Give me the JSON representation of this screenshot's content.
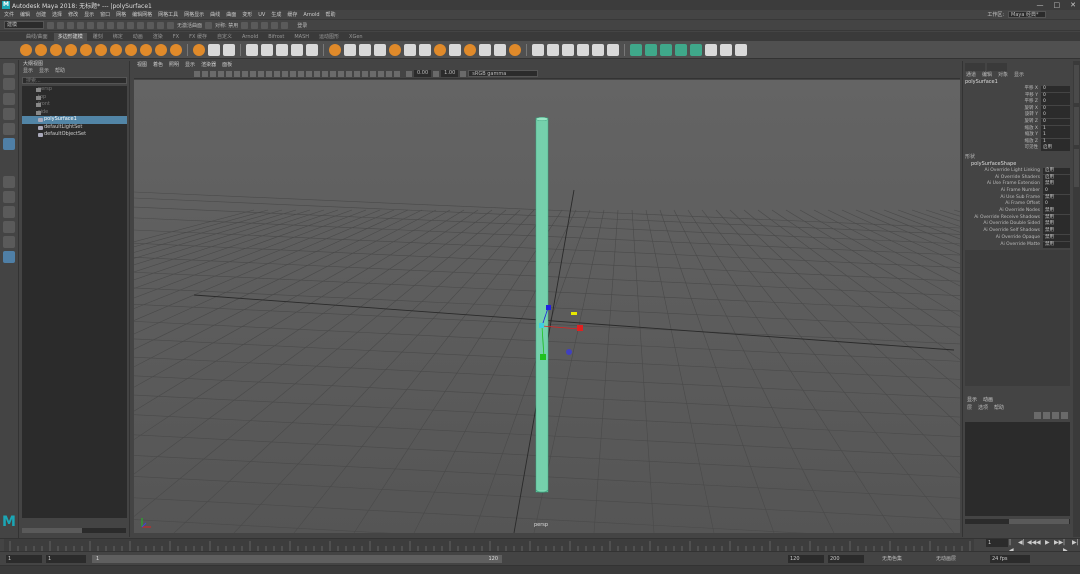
{
  "window": {
    "title": "Autodesk Maya 2018: 无标题*   ---   |polySurface1",
    "logo_letter": "M",
    "controls": [
      "—",
      "□",
      "✕"
    ]
  },
  "menubar": {
    "items": [
      "文件",
      "编辑",
      "创建",
      "选择",
      "修改",
      "显示",
      "窗口",
      "网格",
      "编辑网格",
      "网格工具",
      "网格显示",
      "曲线",
      "曲面",
      "变形",
      "UV",
      "生成",
      "缓存",
      "Arnold",
      "帮助"
    ],
    "workspace_label": "工作区:",
    "workspace_value": "Maya 经典*"
  },
  "statusline": {
    "mode_value": "建模",
    "no_live_surface": "无激活曲面",
    "symmetry": "对称: 禁用",
    "login": "登录"
  },
  "shelf": {
    "tabs": [
      "曲线/曲面",
      "多边形建模",
      "雕刻",
      "绑定",
      "动画",
      "渲染",
      "FX",
      "FX 缓存",
      "自定义",
      "Arnold",
      "Bifrost",
      "MASH",
      "运动图形",
      "XGen"
    ],
    "active_tab": 1
  },
  "outliner": {
    "panel_title": "大纲视图",
    "menu": [
      "显示",
      "显示",
      "帮助"
    ],
    "search_placeholder": "搜索...",
    "items": [
      {
        "label": "persp",
        "type": "camera"
      },
      {
        "label": "top",
        "type": "camera"
      },
      {
        "label": "front",
        "type": "camera"
      },
      {
        "label": "side",
        "type": "camera"
      },
      {
        "label": "polySurface1",
        "type": "object",
        "selected": true
      },
      {
        "label": "defaultLightSet",
        "type": "object"
      },
      {
        "label": "defaultObjectSet",
        "type": "object"
      }
    ]
  },
  "viewport": {
    "menu": [
      "视图",
      "着色",
      "照明",
      "显示",
      "渲染器",
      "面板"
    ],
    "exposure": "0.00",
    "gamma": "1.00",
    "colorspace": "sRGB gamma",
    "camera_label": "persp"
  },
  "channelbox": {
    "menu": [
      "通道",
      "编辑",
      "对象",
      "显示"
    ],
    "object_name": "polySurface1",
    "transform_attrs": [
      {
        "name": "平移 X",
        "value": "0"
      },
      {
        "name": "平移 Y",
        "value": "0"
      },
      {
        "name": "平移 Z",
        "value": "0"
      },
      {
        "name": "旋转 X",
        "value": "0"
      },
      {
        "name": "旋转 Y",
        "value": "0"
      },
      {
        "name": "旋转 Z",
        "value": "0"
      },
      {
        "name": "缩放 X",
        "value": "1"
      },
      {
        "name": "缩放 Y",
        "value": "1"
      },
      {
        "name": "缩放 Z",
        "value": "1"
      },
      {
        "name": "可见性",
        "value": "启用"
      }
    ],
    "shapes_label": "形状",
    "shape_name": "polySurfaceShape",
    "shape_attrs": [
      {
        "name": "Ai Override Light Linking",
        "value": "启用"
      },
      {
        "name": "Ai Override Shaders",
        "value": "启用"
      },
      {
        "name": "Ai Use Frame Extension",
        "value": "禁用"
      },
      {
        "name": "Ai Frame Number",
        "value": "0"
      },
      {
        "name": "Ai Use Sub Frame",
        "value": "禁用"
      },
      {
        "name": "Ai Frame Offset",
        "value": "0"
      },
      {
        "name": "Ai Override Nodes",
        "value": "禁用"
      },
      {
        "name": "Ai Override Receive Shadows",
        "value": "禁用"
      },
      {
        "name": "Ai Override Double Sided",
        "value": "禁用"
      },
      {
        "name": "Ai Override Self Shadows",
        "value": "禁用"
      },
      {
        "name": "Ai Override Opaque",
        "value": "禁用"
      },
      {
        "name": "Ai Override Matte",
        "value": "禁用"
      }
    ]
  },
  "layers": {
    "tabs": [
      "显示",
      "动画"
    ],
    "menu": [
      "层",
      "选项",
      "帮助"
    ]
  },
  "timeline": {
    "current_frame": "1",
    "range_start": "1",
    "range_inner_start": "1",
    "range_inner_end": "120",
    "range_end_a": "120",
    "range_end_b": "200",
    "char_set": "无角色集",
    "anim_layer": "无动画层",
    "fps": "24 fps",
    "playback": [
      "|◀",
      "◀|",
      "◀◀",
      "◀",
      "▶",
      "▶▶",
      "|▶",
      "▶|"
    ]
  },
  "colors": {
    "accent": "#1ba6b5",
    "selected_row": "#5285a6",
    "cylinder": "#7fd9b4",
    "manip_x": "#e02020",
    "manip_y": "#20c020",
    "manip_z": "#2020e0"
  }
}
